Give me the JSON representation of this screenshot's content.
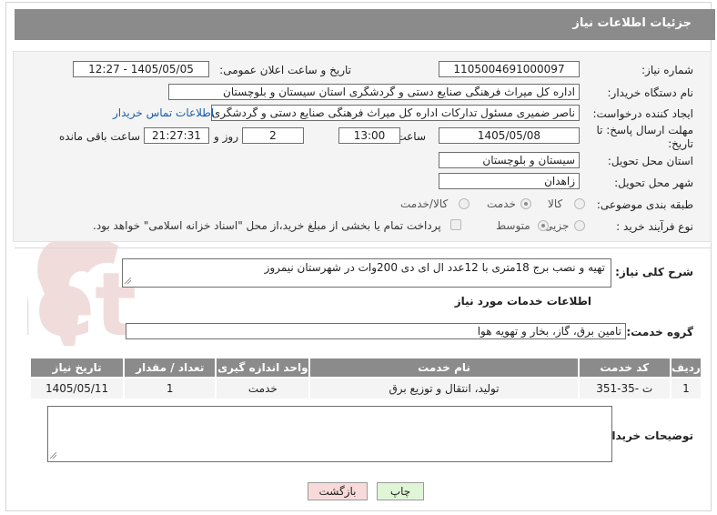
{
  "header": {
    "title": "جزئیات اطلاعات نیاز"
  },
  "form": {
    "need_number": {
      "label": "شماره نیاز:",
      "value": "1105004691000097"
    },
    "announce_datetime": {
      "label": "تاریخ و ساعت اعلان عمومی:",
      "value": "1405/05/05 - 12:27"
    },
    "buyer_org": {
      "label": "نام دستگاه خریدار:",
      "value": "اداره کل میراث فرهنگی  صنایع دستی و گردشگری استان سیستان و بلوچستان"
    },
    "requester": {
      "label": "ایجاد کننده درخواست:",
      "value": "ناصر ضمیری مسئول تدارکات اداره کل میراث فرهنگی  صنایع دستی و گردشگری",
      "contact_link": "اطلاعات تماس خریدار"
    },
    "deadline": {
      "label": "مهلت ارسال پاسخ: تا تاریخ:",
      "date": "1405/05/08",
      "time_label": "ساعت",
      "time": "13:00",
      "days": "2",
      "days_label": "روز و",
      "remaining": "21:27:31",
      "remaining_label": "ساعت باقی مانده"
    },
    "province": {
      "label": "استان محل تحویل:",
      "value": "سیستان و بلوچستان"
    },
    "city": {
      "label": "شهر محل تحویل:",
      "value": "زاهدان"
    },
    "category": {
      "label": "طبقه بندی موضوعی:",
      "options": [
        "کالا",
        "خدمت",
        "کالا/خدمت"
      ],
      "selected": "خدمت"
    },
    "process": {
      "label": "نوع فرآیند خرید :",
      "options": [
        "جزیی",
        "متوسط"
      ],
      "selected": "متوسط",
      "payment_note": "پرداخت تمام یا بخشی از مبلغ خرید،از محل \"اسناد خزانه اسلامی\" خواهد بود."
    }
  },
  "description": {
    "label": "شرح کلی نیاز:",
    "value": "تهیه و نصب برج 18متری با 12عدد ال ای دی 200وات در شهرستان نیمروز"
  },
  "services": {
    "section_title": "اطلاعات خدمات مورد نیاز",
    "group_label": "گروه خدمت:",
    "group_value": "تامین برق، گاز، بخار و تهویه هوا",
    "table": {
      "headers": [
        "ردیف",
        "کد خدمت",
        "نام خدمت",
        "واحد اندازه گیری",
        "تعداد / مقدار",
        "تاریخ نیاز"
      ],
      "rows": [
        [
          "1",
          "ت -35-351",
          "تولید، انتقال و توزیع برق",
          "خدمت",
          "1",
          "1405/05/11"
        ]
      ]
    }
  },
  "buyer_notes": {
    "label": "توضیحات خریدار:",
    "value": ""
  },
  "buttons": {
    "print": "چاپ",
    "back": "بازگشت"
  },
  "watermark": {
    "text": "AriaTender.net"
  },
  "colors": {
    "header_bg": "#8b8b8b",
    "panel_bg": "#f4f4f4",
    "link": "#1a5ea8",
    "back_btn_bg": "#f8dada",
    "print_btn_bg": "#dff5d6",
    "watermark": "#f1dcdc"
  }
}
